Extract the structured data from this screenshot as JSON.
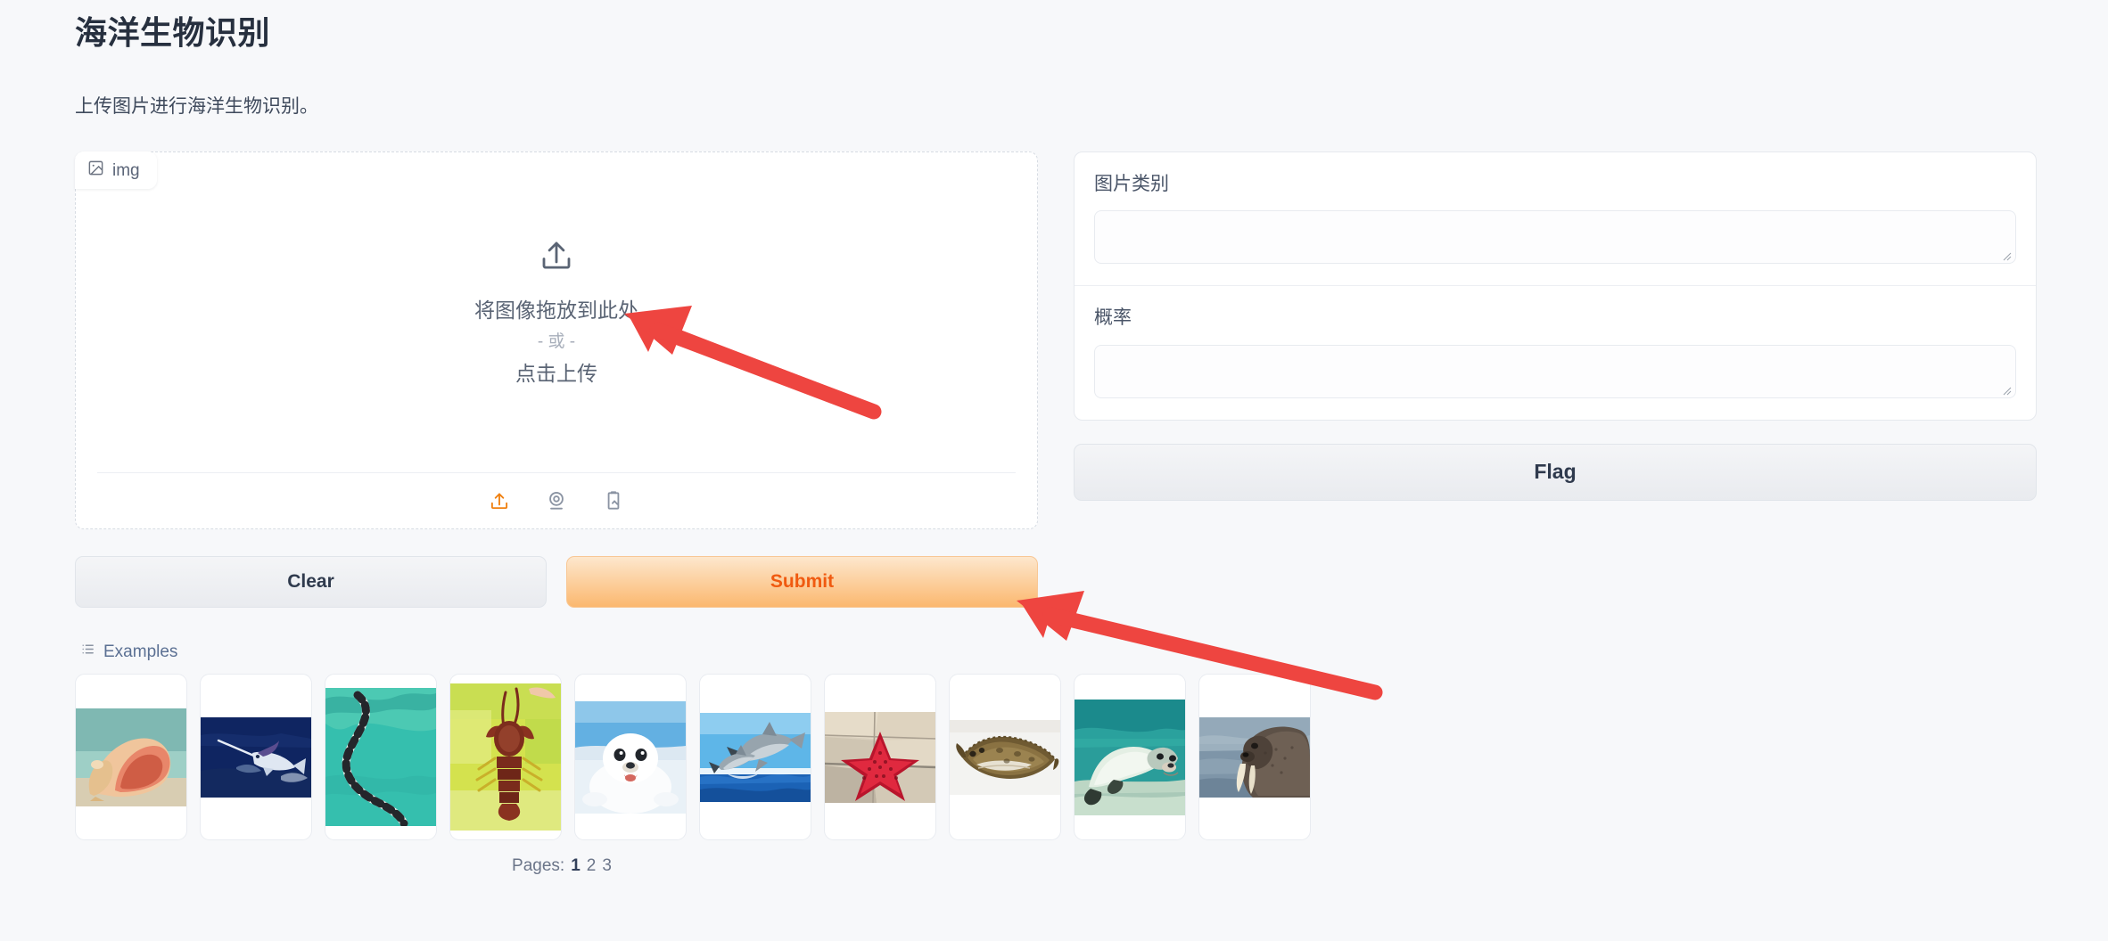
{
  "header": {
    "title": "海洋生物识别",
    "subtitle": "上传图片进行海洋生物识别。"
  },
  "image_input": {
    "tab_label": "img",
    "tab_icon": "image-icon",
    "drop_text_line1": "将图像拖放到此处",
    "drop_text_or": "- 或 -",
    "drop_text_line2": "点击上传",
    "upload_icon": "upload-arrow-icon",
    "sources": [
      {
        "name": "upload-source-button",
        "icon": "upload-icon",
        "color": "#f08010"
      },
      {
        "name": "webcam-source-button",
        "icon": "webcam-icon",
        "color": "#8b94a3"
      },
      {
        "name": "clipboard-source-button",
        "icon": "clipboard-image-icon",
        "color": "#8b94a3"
      }
    ]
  },
  "actions": {
    "clear_label": "Clear",
    "submit_label": "Submit",
    "submit_color": "#f05a10"
  },
  "outputs": {
    "fields": [
      {
        "label": "图片类别",
        "value": ""
      },
      {
        "label": "概率",
        "value": ""
      }
    ],
    "flag_label": "Flag"
  },
  "examples": {
    "title": "Examples",
    "icon": "list-icon",
    "items": [
      {
        "name": "conch-shell-on-beach",
        "alt": "海螺"
      },
      {
        "name": "marlin-leaping",
        "alt": "旗鱼"
      },
      {
        "name": "sea-snake-in-water",
        "alt": "海蛇"
      },
      {
        "name": "spiny-lobster",
        "alt": "龙虾"
      },
      {
        "name": "harp-seal-pup",
        "alt": "海豹幼崽"
      },
      {
        "name": "dolphins-jumping",
        "alt": "海豚"
      },
      {
        "name": "red-starfish-on-rock",
        "alt": "海星"
      },
      {
        "name": "flounder-flatfish",
        "alt": "比目鱼"
      },
      {
        "name": "sea-lion-underwater",
        "alt": "海狮"
      },
      {
        "name": "walrus-in-sea",
        "alt": "海象"
      }
    ],
    "pages_label": "Pages:",
    "pages": [
      "1",
      "2",
      "3"
    ],
    "active_page": "1"
  },
  "annotations": {
    "arrow_color": "#ee4540",
    "arrows": [
      {
        "name": "arrow-pointing-to-dropzone",
        "target": "drop-zone"
      },
      {
        "name": "arrow-pointing-to-submit",
        "target": "submit-button"
      }
    ]
  }
}
